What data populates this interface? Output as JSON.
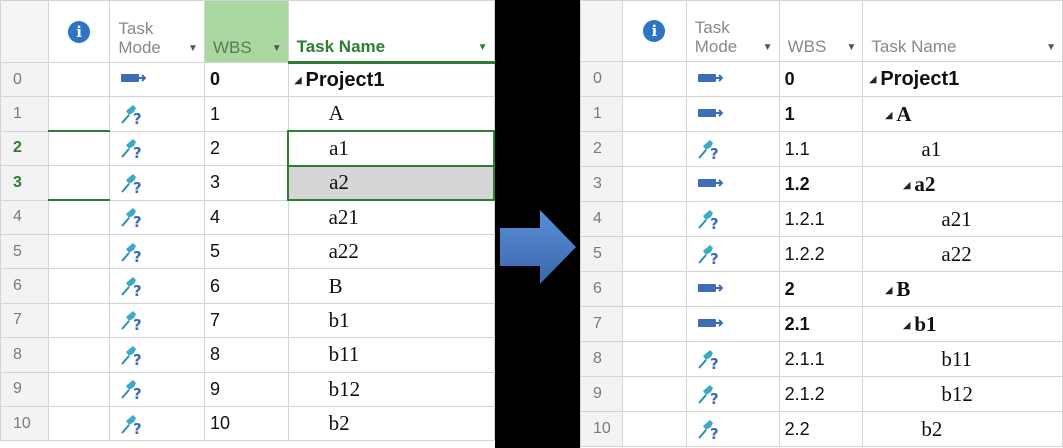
{
  "left": {
    "headers": {
      "task_mode_line1": "Task",
      "task_mode_line2": "Mode",
      "wbs": "WBS",
      "task_name": "Task Name"
    },
    "rows": [
      {
        "num": "0",
        "mode": "auto",
        "wbs": "0",
        "name": "Project1"
      },
      {
        "num": "1",
        "mode": "manual",
        "wbs": "1",
        "name": "A"
      },
      {
        "num": "2",
        "mode": "manual",
        "wbs": "2",
        "name": "a1"
      },
      {
        "num": "3",
        "mode": "manual",
        "wbs": "3",
        "name": "a2"
      },
      {
        "num": "4",
        "mode": "manual",
        "wbs": "4",
        "name": "a21"
      },
      {
        "num": "5",
        "mode": "manual",
        "wbs": "5",
        "name": "a22"
      },
      {
        "num": "6",
        "mode": "manual",
        "wbs": "6",
        "name": "B"
      },
      {
        "num": "7",
        "mode": "manual",
        "wbs": "7",
        "name": "b1"
      },
      {
        "num": "8",
        "mode": "manual",
        "wbs": "8",
        "name": "b11"
      },
      {
        "num": "9",
        "mode": "manual",
        "wbs": "9",
        "name": "b12"
      },
      {
        "num": "10",
        "mode": "manual",
        "wbs": "10",
        "name": "b2"
      }
    ]
  },
  "right": {
    "headers": {
      "task_mode_line1": "Task",
      "task_mode_line2": "Mode",
      "wbs": "WBS",
      "task_name": "Task Name"
    },
    "rows": [
      {
        "num": "0",
        "mode": "auto",
        "wbs": "0",
        "name": "Project1"
      },
      {
        "num": "1",
        "mode": "auto",
        "wbs": "1",
        "name": "A"
      },
      {
        "num": "2",
        "mode": "manual",
        "wbs": "1.1",
        "name": "a1"
      },
      {
        "num": "3",
        "mode": "auto",
        "wbs": "1.2",
        "name": "a2"
      },
      {
        "num": "4",
        "mode": "manual",
        "wbs": "1.2.1",
        "name": "a21"
      },
      {
        "num": "5",
        "mode": "manual",
        "wbs": "1.2.2",
        "name": "a22"
      },
      {
        "num": "6",
        "mode": "auto",
        "wbs": "2",
        "name": "B"
      },
      {
        "num": "7",
        "mode": "auto",
        "wbs": "2.1",
        "name": "b1"
      },
      {
        "num": "8",
        "mode": "manual",
        "wbs": "2.1.1",
        "name": "b11"
      },
      {
        "num": "9",
        "mode": "manual",
        "wbs": "2.1.2",
        "name": "b12"
      },
      {
        "num": "10",
        "mode": "manual",
        "wbs": "2.2",
        "name": "b2"
      }
    ]
  },
  "colors": {
    "selection_green": "#2e7d32",
    "wbs_header_green": "#a8d8a0",
    "arrow_blue": "#3f6fb8",
    "info_blue": "#2e73c4"
  },
  "icons": {
    "info": "info-icon",
    "auto_schedule": "auto-scheduled-task-icon",
    "manual_schedule": "manually-scheduled-task-icon",
    "collapse": "collapse-triangle-icon",
    "dropdown": "dropdown-arrow-icon"
  }
}
